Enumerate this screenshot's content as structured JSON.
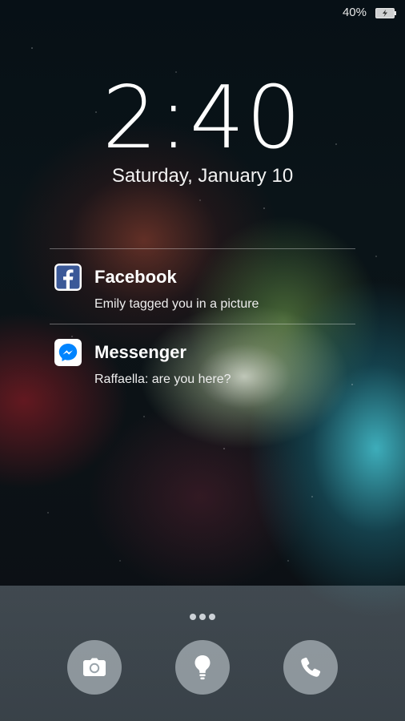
{
  "status_bar": {
    "battery_percent": "40%",
    "battery_icon": "battery-charging-icon"
  },
  "lockscreen": {
    "time": "2:40",
    "date": "Saturday, January 10"
  },
  "notifications": [
    {
      "app": "Facebook",
      "text": "Emily tagged you in a picture",
      "icon": "facebook-icon",
      "color": "#3b5998"
    },
    {
      "app": "Messenger",
      "text": "Raffaella: are you here?",
      "icon": "messenger-icon",
      "color": "#0084ff"
    }
  ],
  "dock": {
    "shortcuts": [
      {
        "icon": "camera-icon"
      },
      {
        "icon": "flashlight-icon"
      },
      {
        "icon": "phone-icon"
      }
    ]
  }
}
